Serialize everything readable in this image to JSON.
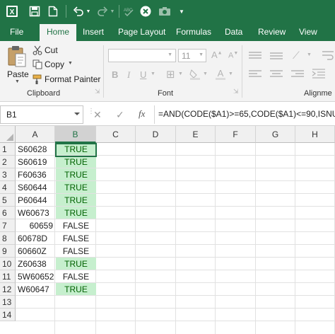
{
  "qat": {
    "icons": [
      "excel-logo-icon",
      "save-icon",
      "new-file-icon",
      "undo-icon",
      "redo-icon",
      "spelling-check-icon",
      "close-circle-icon",
      "camera-icon",
      "customize-qat-icon"
    ]
  },
  "tabs": [
    "File",
    "Home",
    "Insert",
    "Page Layout",
    "Formulas",
    "Data",
    "Review",
    "View"
  ],
  "ribbon": {
    "clipboard": {
      "paste": "Paste",
      "cut": "Cut",
      "copy": "Copy",
      "format_painter": "Format Painter",
      "label": "Clipboard"
    },
    "font": {
      "font_size": "11",
      "label": "Font"
    },
    "alignment": {
      "label": "Alignme"
    }
  },
  "formula_bar": {
    "name_box": "B1",
    "fx": "fx",
    "formula": "=AND(CODE($A1)>=65,CODE($A1)<=90,ISNU"
  },
  "grid": {
    "columns": [
      "A",
      "B",
      "C",
      "D",
      "E",
      "F",
      "G",
      "H"
    ],
    "selected_column": "B",
    "rows": [
      {
        "n": "1",
        "a": "S60628",
        "b": "TRUE",
        "ok": true,
        "num": false
      },
      {
        "n": "2",
        "a": "S60619",
        "b": "TRUE",
        "ok": true,
        "num": false
      },
      {
        "n": "3",
        "a": "F60636",
        "b": "TRUE",
        "ok": true,
        "num": false
      },
      {
        "n": "4",
        "a": "S60644",
        "b": "TRUE",
        "ok": true,
        "num": false
      },
      {
        "n": "5",
        "a": "P60644",
        "b": "TRUE",
        "ok": true,
        "num": false
      },
      {
        "n": "6",
        "a": "W60673",
        "b": "TRUE",
        "ok": true,
        "num": false
      },
      {
        "n": "7",
        "a": "60659",
        "b": "FALSE",
        "ok": false,
        "num": true
      },
      {
        "n": "8",
        "a": "60678D",
        "b": "FALSE",
        "ok": false,
        "num": false
      },
      {
        "n": "9",
        "a": "60660Z",
        "b": "FALSE",
        "ok": false,
        "num": false
      },
      {
        "n": "10",
        "a": "Z60638",
        "b": "TRUE",
        "ok": true,
        "num": false
      },
      {
        "n": "11",
        "a": "5W60652",
        "b": "FALSE",
        "ok": false,
        "num": false
      },
      {
        "n": "12",
        "a": "W60647",
        "b": "TRUE",
        "ok": true,
        "num": false
      },
      {
        "n": "13",
        "a": "",
        "b": "",
        "ok": false,
        "num": false
      },
      {
        "n": "14",
        "a": "",
        "b": "",
        "ok": false,
        "num": false
      }
    ]
  },
  "colors": {
    "brand": "#217346",
    "true_fill": "#c6efce",
    "true_text": "#006100"
  }
}
